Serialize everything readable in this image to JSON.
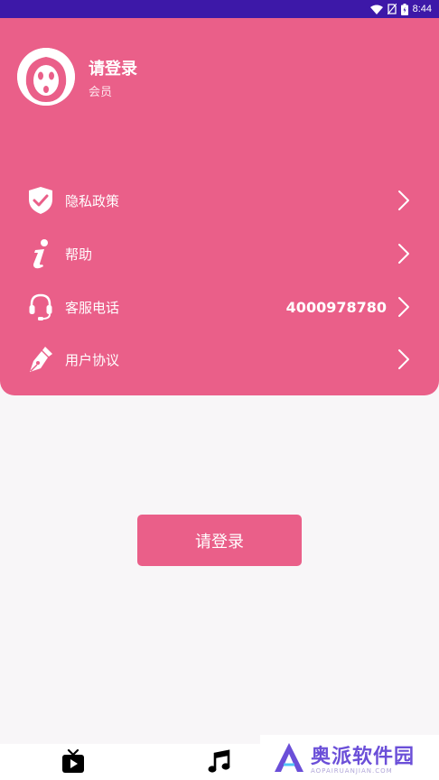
{
  "status_bar": {
    "time": "8:44",
    "icons": [
      "wifi-icon",
      "no-sim-icon",
      "battery-icon"
    ],
    "color": "#3d18a8"
  },
  "profile": {
    "name": "请登录",
    "subtitle": "会员",
    "avatar_icon": "ghost-face-avatar"
  },
  "menu": [
    {
      "label": "隐私政策",
      "icon": "shield-check-icon",
      "value": ""
    },
    {
      "label": "帮助",
      "icon": "info-icon",
      "value": ""
    },
    {
      "label": "客服电话",
      "icon": "headset-icon",
      "value": "4000978780"
    },
    {
      "label": "用户协议",
      "icon": "pen-nib-icon",
      "value": ""
    }
  ],
  "login_button": {
    "label": "请登录"
  },
  "bottom_nav": [
    {
      "icon": "video-play-icon"
    },
    {
      "icon": "music-note-icon"
    }
  ],
  "watermark": {
    "title": "奥派软件园",
    "url": "AOPAIRUANJIAN.COM"
  },
  "colors": {
    "accent": "#ea5f89",
    "background": "#f8f6f8"
  }
}
